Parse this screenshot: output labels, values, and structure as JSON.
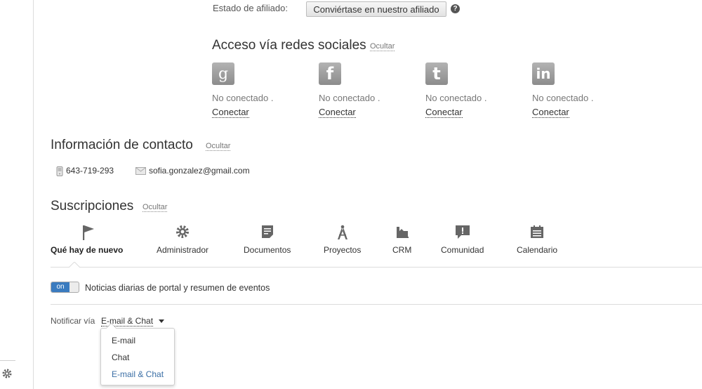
{
  "affiliate": {
    "label": "Estado de afiliado:",
    "button": "Conviértase en nuestro afiliado",
    "help": "?"
  },
  "social": {
    "title": "Acceso vía redes sociales",
    "hide": "Ocultar",
    "providers": [
      {
        "name": "google",
        "icon": "google-icon",
        "glyph": "g",
        "status": "No conectado .",
        "connect": "Conectar"
      },
      {
        "name": "facebook",
        "icon": "facebook-icon",
        "glyph": "f",
        "status": "No conectado .",
        "connect": "Conectar"
      },
      {
        "name": "twitter",
        "icon": "twitter-icon",
        "glyph": "t",
        "status": "No conectado .",
        "connect": "Conectar"
      },
      {
        "name": "linkedin",
        "icon": "linkedin-icon",
        "glyph": "in",
        "status": "No conectado .",
        "connect": "Conectar"
      }
    ]
  },
  "contact": {
    "title": "Información de contacto",
    "hide": "Ocultar",
    "phone": "643-719-293",
    "email": "sofia.gonzalez@gmail.com"
  },
  "subscriptions": {
    "title": "Suscripciones",
    "hide": "Ocultar",
    "tabs": [
      {
        "label": "Qué hay de nuevo",
        "icon": "flag-icon"
      },
      {
        "label": "Administrador",
        "icon": "gear-icon"
      },
      {
        "label": "Documentos",
        "icon": "document-icon"
      },
      {
        "label": "Proyectos",
        "icon": "compass-icon"
      },
      {
        "label": "CRM",
        "icon": "crm-icon"
      },
      {
        "label": "Comunidad",
        "icon": "speech-bubble-icon"
      },
      {
        "label": "Calendario",
        "icon": "calendar-icon"
      }
    ],
    "active_tab": "Qué hay de nuevo",
    "toggle_state": "on",
    "toggle_text": "Noticias diarias de portal y resumen de eventos",
    "notify_label": "Notificar vía",
    "notify_value": "E-mail & Chat",
    "notify_options": [
      "E-mail",
      "Chat",
      "E-mail & Chat"
    ]
  },
  "colors": {
    "accent": "#3a7bbf",
    "selected_option": "#3a6ea5"
  }
}
